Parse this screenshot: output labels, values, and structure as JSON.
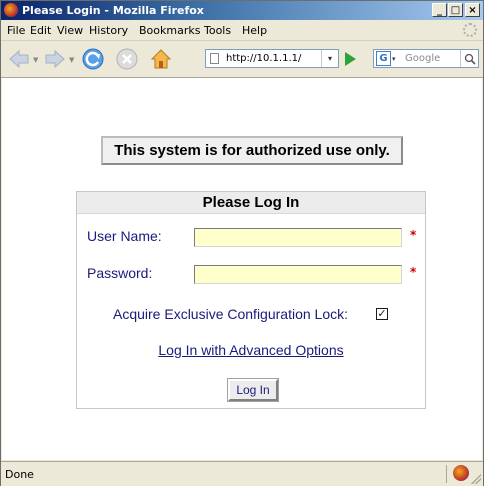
{
  "window": {
    "title": "Please Login - Mozilla Firefox",
    "minimize_label": "_",
    "maximize_label": "□",
    "close_label": "×"
  },
  "menu": {
    "items": [
      "File",
      "Edit",
      "View",
      "History",
      "Bookmarks",
      "Tools",
      "Help"
    ]
  },
  "toolbar": {
    "url": "http://10.1.1.1/",
    "url_dropdown": "▾",
    "search_engine_letter": "G",
    "search_engine_drop": "▾",
    "search_placeholder": "Google",
    "search_button": "🔍",
    "colors": {
      "go": "#2ea33c",
      "back_forward": "#b9c6da"
    }
  },
  "page": {
    "notice": "This system is for authorized use only.",
    "login": {
      "header": "Please Log In",
      "username_label": "User Name:",
      "username_value": "",
      "password_label": "Password:",
      "password_value": "",
      "required_mark": "*",
      "lock_label": "Acquire Exclusive Configuration Lock:",
      "lock_checked": true,
      "lock_check_glyph": "✓",
      "advanced_link": "Log In with Advanced Options",
      "login_button": "Log In",
      "colors": {
        "input_bg": "#ffffcc",
        "label": "#1a1a7a",
        "required": "#cc0000"
      }
    }
  },
  "status": {
    "text": "Done"
  }
}
